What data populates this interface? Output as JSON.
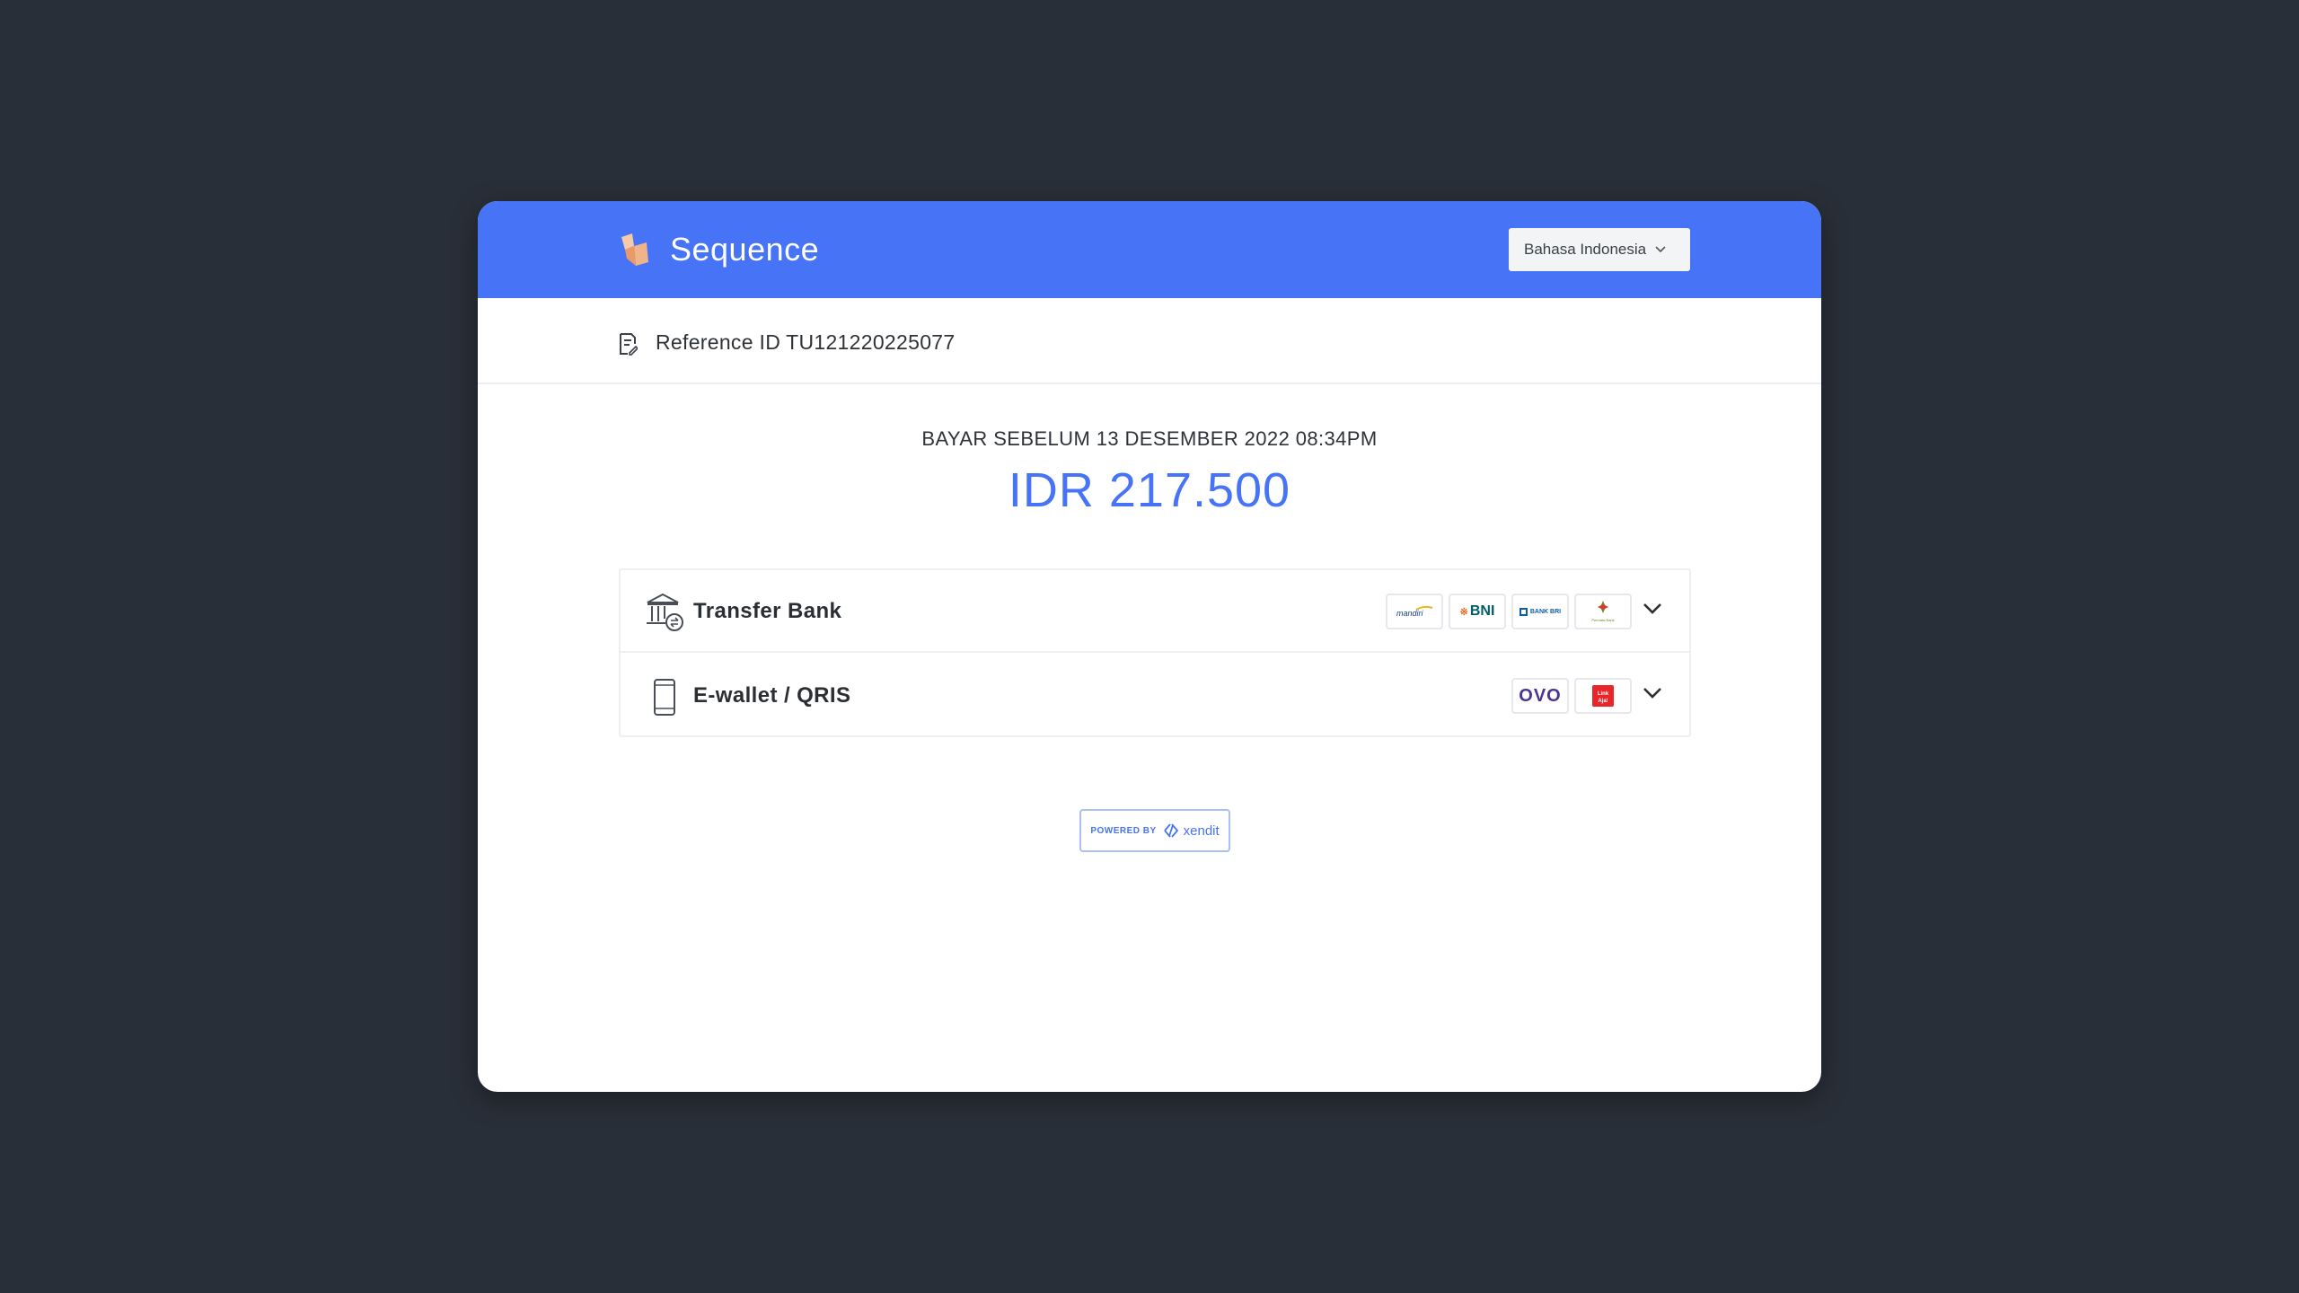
{
  "app": {
    "name": "Sequence"
  },
  "language_select": {
    "value": "Bahasa Indonesia"
  },
  "reference": {
    "label": "Reference ID",
    "id": "TU121220225077"
  },
  "payment": {
    "due_text": "BAYAR SEBELUM 13 DESEMBER 2022 08:34PM",
    "amount": "IDR 217.500"
  },
  "methods": [
    {
      "label": "Transfer Bank",
      "icon": "bank-icon",
      "providers": [
        "mandiri",
        "BNI",
        "BANK BRI",
        "Permata Bank"
      ]
    },
    {
      "label": "E-wallet / QRIS",
      "icon": "phone-icon",
      "providers": [
        "OVO",
        "LinkAja"
      ]
    }
  ],
  "footer": {
    "powered_by": "POWERED BY",
    "brand": "xendit"
  },
  "colors": {
    "header": "#4773f6",
    "amount": "#4773f6",
    "background": "#292f38"
  }
}
